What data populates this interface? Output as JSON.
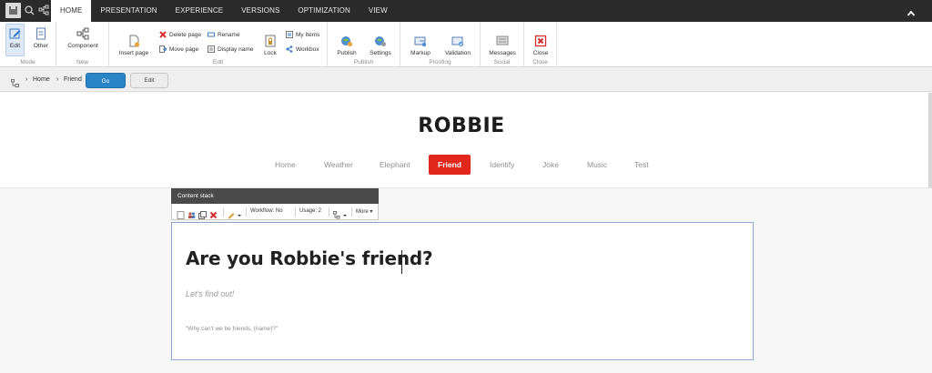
{
  "top_tabs": [
    "HOME",
    "PRESENTATION",
    "EXPERIENCE",
    "VERSIONS",
    "OPTIMIZATION",
    "VIEW"
  ],
  "ribbon": {
    "mode": {
      "label": "Mode",
      "edit": "Edit",
      "other": "Other"
    },
    "new": {
      "label": "New",
      "component": "Component"
    },
    "edit": {
      "label": "Edit",
      "insert_page": "Insert page",
      "delete_page": "Delete page",
      "move_page": "Move page",
      "rename": "Rename",
      "display_name": "Display name",
      "lock": "Lock",
      "my_items": "My Items",
      "workbox": "Workbox"
    },
    "publish": {
      "label": "Publish",
      "publish": "Publish",
      "settings": "Settings"
    },
    "proofing": {
      "label": "Proofing",
      "markup": "Markup",
      "validation": "Validation"
    },
    "social": {
      "label": "Social",
      "messages": "Messages"
    },
    "close": {
      "label": "Close",
      "close": "Close"
    }
  },
  "breadcrumb": {
    "items": [
      "Home",
      "Friend"
    ],
    "go": "Go",
    "edit": "Edit"
  },
  "site": {
    "logo": "ROBBIE",
    "nav": [
      "Home",
      "Weather",
      "Elephant",
      "Friend",
      "Identify",
      "Joke",
      "Music",
      "Test"
    ],
    "active_nav": "Friend"
  },
  "content_stack": {
    "title": "Content stack",
    "workflow": "Workflow: No",
    "usage": "Usage: 2",
    "more": "More"
  },
  "content": {
    "heading": "Are you Robbie's friend?",
    "subheading": "Let's find out!",
    "quote": "\"Why can't we be friends, {name}?\""
  },
  "colors": {
    "accent_red": "#e1261c",
    "go_blue": "#2b84c6",
    "topbar": "#2b2b2b"
  }
}
